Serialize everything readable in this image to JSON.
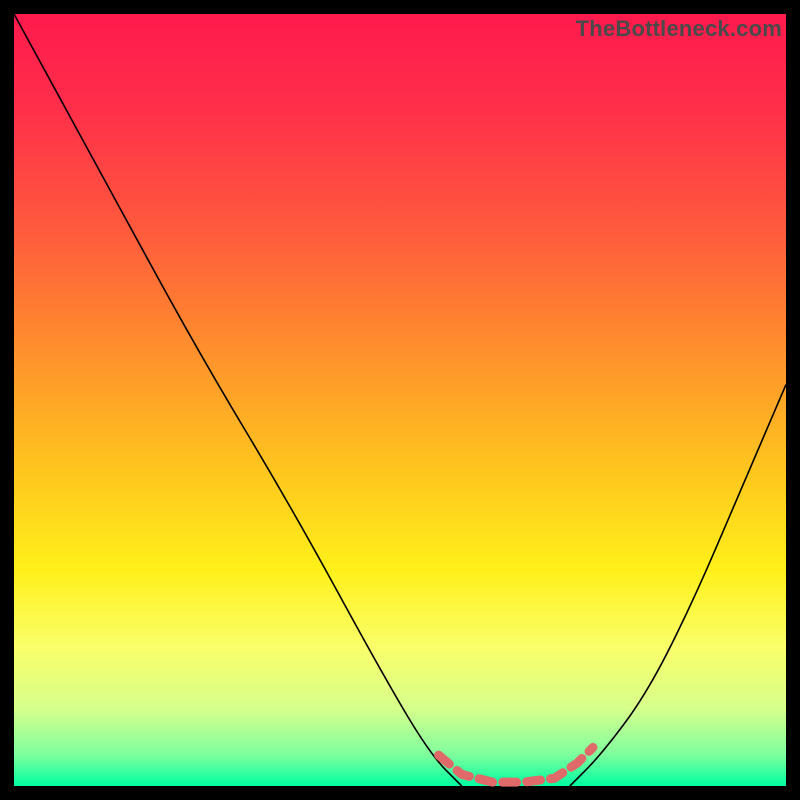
{
  "watermark": "TheBottleneck.com",
  "chart_data": {
    "type": "line",
    "title": "",
    "xlabel": "",
    "ylabel": "",
    "xlim": [
      0,
      100
    ],
    "ylim": [
      0,
      100
    ],
    "left_curve": {
      "x": [
        0,
        12,
        24,
        36,
        48,
        54,
        58
      ],
      "y": [
        100,
        78,
        56,
        36,
        14,
        4,
        0
      ]
    },
    "right_curve": {
      "x": [
        72,
        76,
        82,
        88,
        94,
        100
      ],
      "y": [
        0,
        4,
        12,
        24,
        38,
        52
      ]
    },
    "flat_region": {
      "x": [
        58,
        72
      ],
      "y": 0
    },
    "peak_marker": {
      "points": [
        {
          "x": 55,
          "y": 4
        },
        {
          "x": 58,
          "y": 1.5
        },
        {
          "x": 62,
          "y": 0.5
        },
        {
          "x": 66,
          "y": 0.5
        },
        {
          "x": 70,
          "y": 1
        },
        {
          "x": 73,
          "y": 3
        },
        {
          "x": 75,
          "y": 5
        }
      ]
    },
    "gradient_stops": [
      {
        "pos": 0,
        "color": "#ff1a4d"
      },
      {
        "pos": 28,
        "color": "#ff5a3d"
      },
      {
        "pos": 58,
        "color": "#ffc21f"
      },
      {
        "pos": 82,
        "color": "#faff6a"
      },
      {
        "pos": 100,
        "color": "#00ffa0"
      }
    ]
  }
}
